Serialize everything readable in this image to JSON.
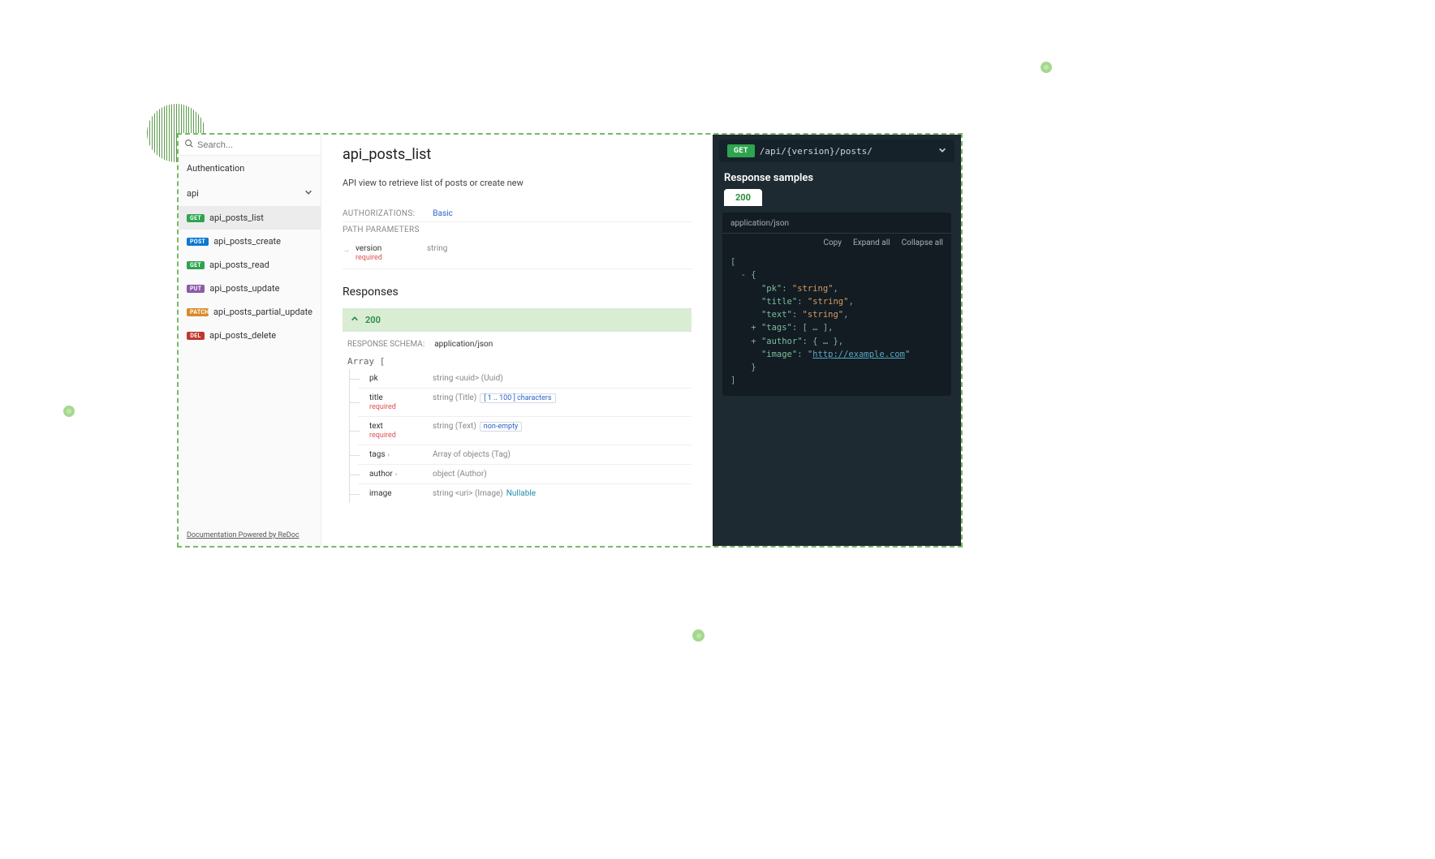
{
  "search": {
    "placeholder": "Search..."
  },
  "sidebar": {
    "auth_label": "Authentication",
    "group_label": "api",
    "items": [
      {
        "method": "GET",
        "mclass": "m-get",
        "label": "api_posts_list",
        "active": true
      },
      {
        "method": "POST",
        "mclass": "m-post",
        "label": "api_posts_create",
        "active": false
      },
      {
        "method": "GET",
        "mclass": "m-get",
        "label": "api_posts_read",
        "active": false
      },
      {
        "method": "PUT",
        "mclass": "m-put",
        "label": "api_posts_update",
        "active": false
      },
      {
        "method": "PATCH",
        "mclass": "m-patch",
        "label": "api_posts_partial_update",
        "active": false
      },
      {
        "method": "DEL",
        "mclass": "m-del",
        "label": "api_posts_delete",
        "active": false
      }
    ],
    "footer": "Documentation Powered by ReDoc"
  },
  "main": {
    "title": "api_posts_list",
    "subtitle": "API view to retrieve list of posts or create new",
    "auth_label": "AUTHORIZATIONS:",
    "auth_value": "Basic",
    "pathparams_label": "PATH PARAMETERS",
    "path_param": {
      "name": "version",
      "required": "required",
      "type": "string"
    },
    "responses_heading": "Responses",
    "resp_code": "200",
    "schema_label": "RESPONSE SCHEMA:",
    "schema_ct": "application/json",
    "array_open": "Array [",
    "fields": [
      {
        "name": "pk",
        "req": false,
        "type": "string <uuid> (Uuid)",
        "extra": "",
        "nullable": false,
        "expand": false
      },
      {
        "name": "title",
        "req": true,
        "type": "string (Title)",
        "extra": "[ 1 .. 100 ] characters",
        "nullable": false,
        "expand": false
      },
      {
        "name": "text",
        "req": true,
        "type": "string (Text)",
        "extra": "non-empty",
        "nullable": false,
        "expand": false
      },
      {
        "name": "tags",
        "req": false,
        "type": "Array of objects (Tag)",
        "extra": "",
        "nullable": false,
        "expand": true
      },
      {
        "name": "author",
        "req": false,
        "type": "object (Author)",
        "extra": "",
        "nullable": false,
        "expand": true
      },
      {
        "name": "image",
        "req": false,
        "type": "string <uri> (Image)",
        "extra": "",
        "nullable": true,
        "expand": false
      }
    ],
    "nullable_label": "Nullable",
    "required_label": "required"
  },
  "right": {
    "method": "GET",
    "path": "/api/{version}/posts/",
    "samples_title": "Response samples",
    "tab": "200",
    "content_type": "application/json",
    "actions": {
      "copy": "Copy",
      "expand": "Expand all",
      "collapse": "Collapse all"
    },
    "sample": {
      "keys": {
        "pk": "pk",
        "title": "title",
        "text": "text",
        "tags": "tags",
        "author": "author",
        "image": "image"
      },
      "str": "string",
      "link": "http://example.com"
    }
  }
}
